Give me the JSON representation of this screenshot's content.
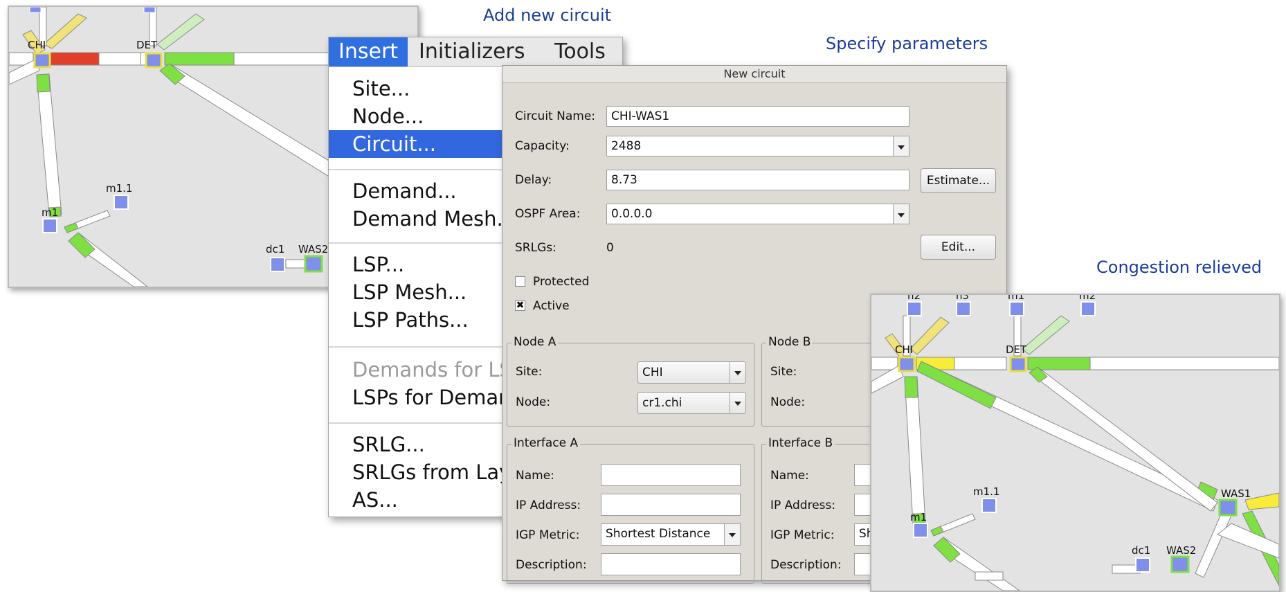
{
  "captions": {
    "add_new_circuit": "Add new circuit",
    "specify_parameters": "Specify parameters",
    "congestion_relieved": "Congestion relieved"
  },
  "map_left": {
    "nodes": [
      "CHI",
      "DET",
      "m1.1",
      "m1",
      "dc1",
      "WAS2"
    ]
  },
  "map_right": {
    "nodes": [
      "n2",
      "n3",
      "m1",
      "m2",
      "CHI",
      "DET",
      "WAS1",
      "m1.1",
      "m1",
      "dc1",
      "WAS2"
    ]
  },
  "menu": {
    "bar": [
      "Insert",
      "Initializers",
      "Tools"
    ],
    "items": [
      "Site...",
      "Node...",
      "Circuit...",
      "Demand...",
      "Demand Mesh...",
      "LSP...",
      "LSP Mesh...",
      "LSP Paths...",
      "Demands for LSPs",
      "LSPs for Demands",
      "SRLG...",
      "SRLGs from Layers",
      "AS..."
    ]
  },
  "dialog": {
    "title": "New circuit",
    "circuit_name_label": "Circuit Name:",
    "circuit_name_value": "CHI-WAS1",
    "capacity_label": "Capacity:",
    "capacity_value": "2488",
    "delay_label": "Delay:",
    "delay_value": "8.73",
    "estimate_button": "Estimate...",
    "ospf_label": "OSPF Area:",
    "ospf_value": "0.0.0.0",
    "srlgs_label": "SRLGs:",
    "srlgs_value": "0",
    "edit_button": "Edit...",
    "protected_label": "Protected",
    "active_label": "Active",
    "active_mark": "✖",
    "node_a": {
      "title": "Node A",
      "site_label": "Site:",
      "site_value": "CHI",
      "node_label": "Node:",
      "node_value": "cr1.chi"
    },
    "node_b": {
      "title": "Node B",
      "site_label": "Site:",
      "node_label": "Node:"
    },
    "interface_a": {
      "title": "Interface A",
      "name_label": "Name:",
      "ip_label": "IP Address:",
      "igp_label": "IGP Metric:",
      "igp_value": "Shortest Distance",
      "desc_label": "Description:"
    },
    "interface_b": {
      "title": "Interface B",
      "name_label": "Name:",
      "ip_label": "IP Address:",
      "igp_label": "IGP Metric:",
      "igp_value": "Sh",
      "desc_label": "Description:"
    }
  },
  "colors": {
    "caption": "#1c3c9a",
    "node_fill": "#7f8fea",
    "link_green": "#7fe043",
    "link_red": "#e0402a",
    "link_yellow": "#f7ec3a",
    "menu_highlight": "#3367df"
  }
}
